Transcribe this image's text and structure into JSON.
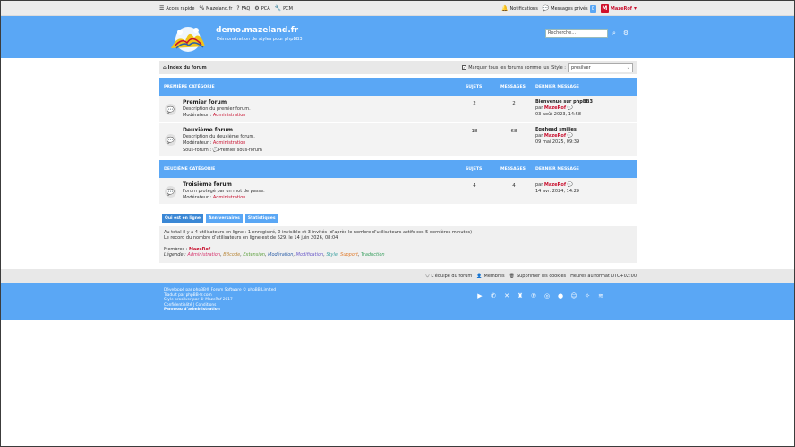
{
  "topbar": {
    "quick_access": "Accès rapide",
    "site_link": "Mazeland.fr",
    "faq": "FAQ",
    "pca": "PCA",
    "pcm": "PCM",
    "notifications": "Notifications",
    "private_messages": "Messages privés",
    "pm_count": "0",
    "avatar_letter": "M",
    "username": "MazeRof"
  },
  "header": {
    "site_title": "demo.mazeland.fr",
    "site_desc": "Démonstration de styles pour phpBB3.",
    "search_placeholder": "Recherche…"
  },
  "navbar": {
    "index": "Index du forum",
    "mark_read": "Marquer tous les forums comme lus",
    "style_label": "Style :",
    "style_value": "prosilver"
  },
  "columns": {
    "topics": "SUJETS",
    "posts": "MESSAGES",
    "last_post": "DERNIER MESSAGE"
  },
  "categories": [
    {
      "name": "PREMIÈRE CATÉGORIE",
      "forums": [
        {
          "title": "Premier forum",
          "desc": "Description du premier forum.",
          "moderator_label": "Modérateur :",
          "moderator": "Administration",
          "topics": "2",
          "posts": "2",
          "last_title": "Bienvenue sur phpBB3",
          "last_by": "par",
          "last_user": "MazeRof",
          "last_date": "03 août 2023, 14:58"
        },
        {
          "title": "Deuxième forum",
          "desc": "Description du deuxième forum.",
          "moderator_label": "Modérateur :",
          "moderator": "Administration",
          "subforum_label": "Sous-forum :",
          "subforum": "Premier sous-forum",
          "topics": "18",
          "posts": "68",
          "last_title": "Egghead smilies",
          "last_by": "par",
          "last_user": "MazeRof",
          "last_date": "09 mai 2025, 09:39"
        }
      ]
    },
    {
      "name": "DEUXIÈME CATÉGORIE",
      "forums": [
        {
          "title": "Troisième forum",
          "desc": "Forum protégé par un mot de passe.",
          "moderator_label": "Modérateur :",
          "moderator": "Administration",
          "topics": "4",
          "posts": "4",
          "last_by": "par",
          "last_user": "MazeRof",
          "last_date": "14 avr. 2024, 14:29"
        }
      ]
    }
  ],
  "tabs": [
    "Qui est en ligne",
    "Anniversaires",
    "Statistiques"
  ],
  "stats": {
    "line1": "Au total il y a 4 utilisateurs en ligne : 1 enregistré, 0 invisible et 3 invités (d’après le nombre d’utilisateurs actifs ces 5 dernières minutes)",
    "line2": "Le record du nombre d’utilisateurs en ligne est de 629, le 14 juin 2026, 08:04",
    "members_label": "Membres :",
    "members": "MazeRof",
    "legend_label": "Légende :",
    "legend": [
      "Administration",
      "BBcode",
      "Extension",
      "Modération",
      "Modification",
      "Style",
      "Support",
      "Traduction"
    ]
  },
  "footer_bar": {
    "team": "L’équipe du forum",
    "members": "Membres",
    "delete_cookies": "Supprimer les cookies",
    "timezone": "Heures au format UTC+02:00"
  },
  "footer": {
    "line1": "Développé par phpBB® Forum Software © phpBB Limited",
    "line2": "Traduit par phpBB-fr.com",
    "line3": "Style prosilver par © MazeRof 2017",
    "line4": "Confidentialité | Conditions",
    "line5": "Panneau d’administration"
  },
  "colors": {
    "accent": "#5aa7f5",
    "user": "#c8102e",
    "bg": "#ffffff"
  }
}
